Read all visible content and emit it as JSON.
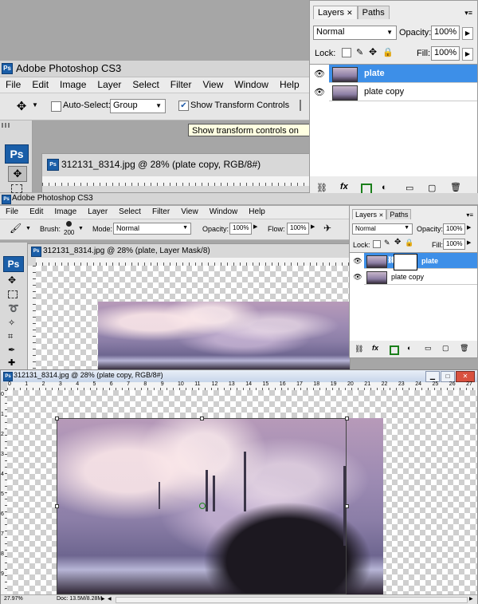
{
  "top_app": {
    "title": "Adobe Photoshop CS3",
    "menu": [
      "File",
      "Edit",
      "Image",
      "Layer",
      "Select",
      "Filter",
      "View",
      "Window",
      "Help"
    ],
    "options": {
      "auto_select_label": "Auto-Select:",
      "auto_select_value": "Group",
      "show_transform_label": "Show Transform Controls"
    },
    "tooltip": "Show transform controls on",
    "doc_title": "312131_8314.jpg @ 28% (plate copy, RGB/8#)",
    "ps_logo": "Ps"
  },
  "top_layers_panel": {
    "tabs": [
      "Layers",
      "Paths"
    ],
    "blend_mode": "Normal",
    "opacity_label": "Opacity:",
    "opacity_value": "100%",
    "lock_label": "Lock:",
    "fill_label": "Fill:",
    "fill_value": "100%",
    "layers": [
      {
        "name": "plate",
        "selected": true
      },
      {
        "name": "plate copy",
        "selected": false
      }
    ]
  },
  "middle_app": {
    "title": "Adobe Photoshop CS3",
    "menu": [
      "File",
      "Edit",
      "Image",
      "Layer",
      "Select",
      "Filter",
      "View",
      "Window",
      "Help"
    ],
    "options": {
      "brush_label": "Brush:",
      "brush_size": "200",
      "mode_label": "Mode:",
      "mode_value": "Normal",
      "opacity_label": "Opacity:",
      "opacity_value": "100%",
      "flow_label": "Flow:",
      "flow_value": "100%"
    },
    "doc_title": "312131_8314.jpg @ 28% (plate, Layer Mask/8)",
    "ps_logo": "Ps"
  },
  "middle_layers_panel": {
    "tabs": [
      "Layers",
      "Paths"
    ],
    "blend_mode": "Normal",
    "opacity_label": "Opacity:",
    "opacity_value": "100%",
    "lock_label": "Lock:",
    "fill_label": "Fill:",
    "fill_value": "100%",
    "layers": [
      {
        "name": "plate",
        "selected": true
      },
      {
        "name": "plate copy",
        "selected": false
      }
    ]
  },
  "bottom_doc": {
    "title": "312131_8314.jpg @ 28% (plate copy, RGB/8#)",
    "zoom": "27.97%",
    "doc_size": "Doc: 13.5M/8.28M",
    "ruler_h": [
      "0",
      "1",
      "2",
      "3",
      "4",
      "5",
      "6",
      "7",
      "8",
      "9",
      "10",
      "11",
      "12",
      "13",
      "14",
      "15",
      "16",
      "17",
      "18",
      "19",
      "20",
      "21",
      "22",
      "23",
      "24",
      "25",
      "26",
      "27"
    ],
    "ruler_v": [
      "0",
      "1",
      "2",
      "3",
      "4",
      "5",
      "6",
      "7",
      "8",
      "9"
    ]
  },
  "colors": {
    "selection": "#3d8fe8",
    "ps_blue": "#1a5ea8",
    "title_blue": "#2c5f9e"
  }
}
